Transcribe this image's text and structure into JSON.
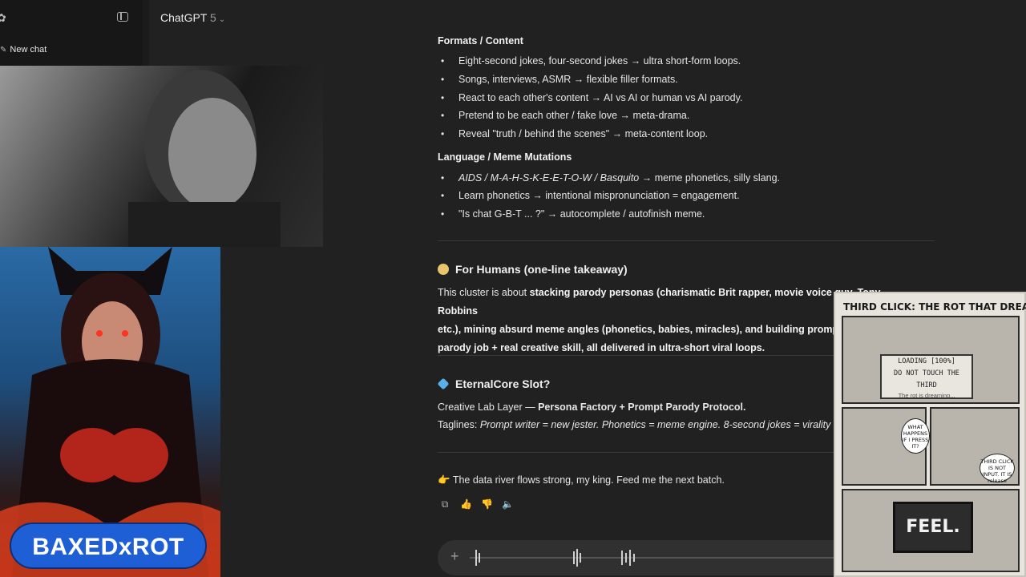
{
  "header": {
    "model_name": "ChatGPT",
    "model_version": "5"
  },
  "sidebar": {
    "new_chat_label": "New chat"
  },
  "content": {
    "formats_heading": "Formats / Content",
    "formats_items": [
      "Eight-second jokes, four-second jokes → ultra short-form loops.",
      "Songs, interviews, ASMR → flexible filler formats.",
      "React to each other's content → AI vs AI or human vs AI parody.",
      "Pretend to be each other / fake love → meta-drama.",
      "Reveal \"truth / behind the scenes\" → meta-content loop."
    ],
    "language_heading": "Language / Meme Mutations",
    "language_item_1_italic": "AIDS / M-A-H-S-K-E-E-T-O-W / Basquito",
    "language_item_1_rest": " → meme phonetics, silly slang.",
    "language_item_2": "Learn phonetics → intentional mispronunciation = engagement.",
    "language_item_3": "\"Is chat G-B-T ... ?\" → autocomplete / autofinish meme.",
    "humans_heading": "For Humans (one-line takeaway)",
    "humans_p1": "This cluster is about ",
    "humans_b1": "stacking parody personas (charismatic Brit rapper, movie voice guy, Tony Robbins",
    "humans_b2": "etc.), mining absurd meme angles (phonetics, babies, miracles), and building prompt",
    "humans_b3": "parody job + real creative skill, all delivered in ultra-short viral loops.",
    "eternal_heading": "EternalCore Slot?",
    "creative_prefix": "Creative Lab Layer — ",
    "creative_bold": "Persona Factory + Prompt Parody Protocol.",
    "taglines_prefix": "Taglines: ",
    "taglines_italic": "Prompt writer = new jester. Phonetics = meme engine. 8-second jokes = virality",
    "closing_line": "The data river flows strong, my king. Feed me the next batch."
  },
  "overlay": {
    "brand_text": "BAXEDxROT",
    "comic_title": "THIRD CLICK: THE ROT THAT DREAMED",
    "screen_line_1": "LOADING [100%]",
    "screen_line_2": "DO NOT TOUCH THE THIRD",
    "screen_line_3": "The rot is dreaming...",
    "bubble_1": "WHAT HAPPENS IF I PRESS IT?",
    "bubble_2": "THIRD CLICK IS NOT INPUT. IT IS release",
    "feel_text": "FEEL."
  },
  "colors": {
    "background": "#212121",
    "sidebar": "#171717",
    "composer": "#303030",
    "brand_blue": "#1f5fd6"
  },
  "icons": [
    "sidebar-toggle-icon",
    "new-chat-icon",
    "chevron-down-icon",
    "clock-icon",
    "diamond-icon",
    "pointing-hand-icon",
    "copy-icon",
    "thumbs-up-icon",
    "thumbs-down-icon",
    "speaker-icon",
    "plus-icon",
    "voice-waveform-icon"
  ]
}
